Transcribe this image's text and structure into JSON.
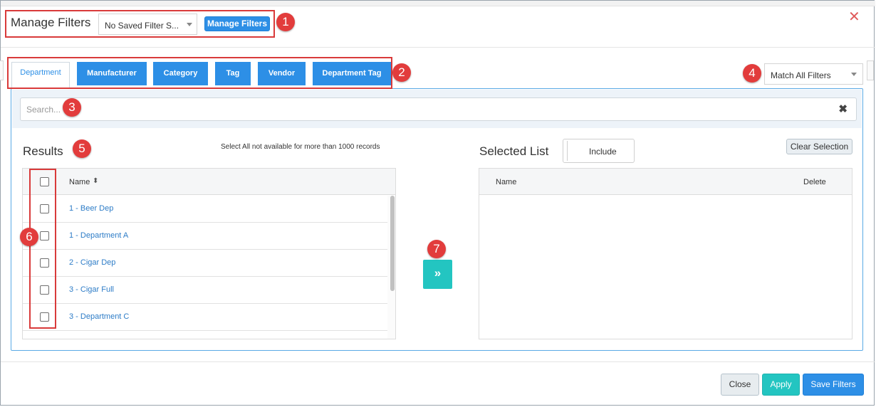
{
  "header": {
    "title": "Manage Filters",
    "saved_filter_value": "No Saved Filter S...",
    "manage_button": "Manage Filters",
    "close_glyph": "✕"
  },
  "tabs": [
    {
      "label": "Department",
      "active": true
    },
    {
      "label": "Manufacturer",
      "active": false
    },
    {
      "label": "Category",
      "active": false
    },
    {
      "label": "Tag",
      "active": false
    },
    {
      "label": "Vendor",
      "active": false
    },
    {
      "label": "Department Tag",
      "active": false
    }
  ],
  "match_select": {
    "value": "Match All Filters"
  },
  "search": {
    "placeholder": "Search...",
    "value": "",
    "clear_glyph": "✖"
  },
  "results": {
    "title": "Results",
    "select_all_note": "Select All not available for more than 1000 records",
    "column_name": "Name",
    "sort_glyph": "⬍",
    "rows": [
      {
        "label": "1 - Beer Dep",
        "checked": false
      },
      {
        "label": "1 - Department A",
        "checked": false
      },
      {
        "label": "2 - Cigar Dep",
        "checked": false
      },
      {
        "label": "3 - Cigar Full",
        "checked": false
      },
      {
        "label": "3 - Department C",
        "checked": false
      }
    ]
  },
  "transfer_button": {
    "glyph": "»"
  },
  "selected_list": {
    "title": "Selected List",
    "include_label": "Include",
    "clear_selection": "Clear Selection",
    "column_name": "Name",
    "column_delete": "Delete",
    "items": []
  },
  "footer": {
    "close": "Close",
    "apply": "Apply",
    "save_filters": "Save Filters"
  },
  "annotations": [
    "1",
    "2",
    "3",
    "4",
    "5",
    "6",
    "7"
  ],
  "colors": {
    "primary": "#2d8fe6",
    "teal": "#23c5c1",
    "annotation_red": "#e23c3c",
    "close_red": "#e05b5b",
    "link_blue": "#2d7cc7",
    "panel_border": "#5aaae5"
  },
  "icons": {
    "header_close": "close-icon",
    "caret": "chevron-down-icon",
    "search_clear": "clear-icon",
    "sort": "sort-icon",
    "transfer": "double-chevron-right-icon"
  }
}
